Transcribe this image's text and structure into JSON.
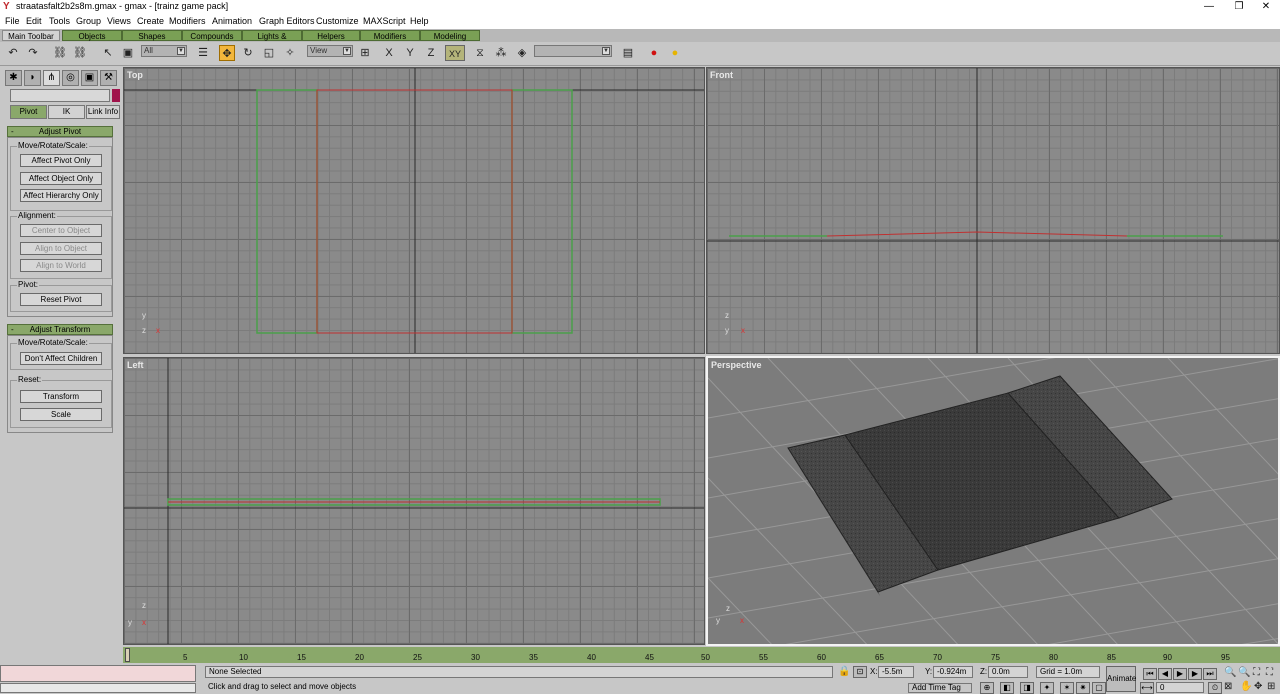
{
  "window": {
    "title": "straatasfalt2b2s8m.gmax - gmax - [trainz game pack]",
    "minimize": "—",
    "restore": "❐",
    "close": "✕"
  },
  "menu": [
    "File",
    "Edit",
    "Tools",
    "Group",
    "Views",
    "Create",
    "Modifiers",
    "Animation",
    "Graph Editors",
    "Customize",
    "MAXScript",
    "Help"
  ],
  "toolbar_tabs": [
    "Main Toolbar",
    "Objects",
    "Shapes",
    "Compounds",
    "Lights & Cameras",
    "Helpers",
    "Modifiers",
    "Modeling"
  ],
  "toolbar": {
    "selection_filter": "All",
    "ref_coord": "View",
    "axis_x": "X",
    "axis_y": "Y",
    "axis_z": "Z",
    "axis_xy": "XY",
    "named_selection": ""
  },
  "command_panel": {
    "subtabs": [
      "Pivot",
      "IK",
      "Link Info"
    ],
    "rollouts": {
      "adjust_pivot": {
        "title": "Adjust Pivot",
        "collapse": "-",
        "move_group": "Move/Rotate/Scale:",
        "affect_pivot": "Affect Pivot Only",
        "affect_object": "Affect Object Only",
        "affect_hierarchy": "Affect Hierarchy Only",
        "alignment_group": "Alignment:",
        "center_to_object": "Center to Object",
        "align_to_object": "Align to Object",
        "align_to_world": "Align to World",
        "pivot_group": "Pivot:",
        "reset_pivot": "Reset Pivot"
      },
      "adjust_transform": {
        "title": "Adjust Transform",
        "collapse": "-",
        "move_group": "Move/Rotate/Scale:",
        "dont_affect": "Don't Affect Children",
        "reset_group": "Reset:",
        "transform": "Transform",
        "scale": "Scale"
      }
    }
  },
  "viewports": {
    "top": {
      "label": "Top",
      "axis_a": "y",
      "axis_b": "x",
      "axis_c": "z"
    },
    "front": {
      "label": "Front",
      "axis_a": "z",
      "axis_b": "x",
      "axis_c": "y"
    },
    "left": {
      "label": "Left",
      "axis_a": "z",
      "axis_b": "y",
      "axis_c": "x"
    },
    "perspective": {
      "label": "Perspective",
      "axis_a": "z",
      "axis_b": "x",
      "axis_c": "y"
    }
  },
  "timeline": {
    "ticks": [
      "5",
      "10",
      "15",
      "20",
      "25",
      "30",
      "35",
      "40",
      "45",
      "50",
      "55",
      "60",
      "65",
      "70",
      "75",
      "80",
      "85",
      "90",
      "95"
    ]
  },
  "status": {
    "selection": "None Selected",
    "prompt": "Click and drag to select and move objects",
    "x_label": "X:",
    "x_value": "-5.5m",
    "y_label": "Y:",
    "y_value": "-0.924m",
    "z_label": "Z:",
    "z_value": "0.0m",
    "grid": "Grid = 1.0m",
    "animate": "Animate",
    "add_time_tag": "Add Time Tag",
    "frame": "0"
  }
}
